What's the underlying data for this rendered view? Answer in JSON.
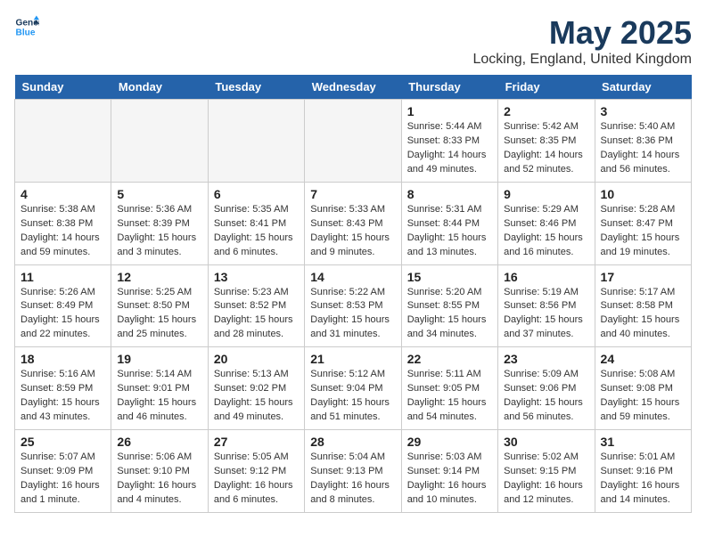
{
  "header": {
    "logo_line1": "General",
    "logo_line2": "Blue",
    "month": "May 2025",
    "location": "Locking, England, United Kingdom"
  },
  "weekdays": [
    "Sunday",
    "Monday",
    "Tuesday",
    "Wednesday",
    "Thursday",
    "Friday",
    "Saturday"
  ],
  "weeks": [
    [
      {
        "day": "",
        "info": ""
      },
      {
        "day": "",
        "info": ""
      },
      {
        "day": "",
        "info": ""
      },
      {
        "day": "",
        "info": ""
      },
      {
        "day": "1",
        "info": "Sunrise: 5:44 AM\nSunset: 8:33 PM\nDaylight: 14 hours\nand 49 minutes."
      },
      {
        "day": "2",
        "info": "Sunrise: 5:42 AM\nSunset: 8:35 PM\nDaylight: 14 hours\nand 52 minutes."
      },
      {
        "day": "3",
        "info": "Sunrise: 5:40 AM\nSunset: 8:36 PM\nDaylight: 14 hours\nand 56 minutes."
      }
    ],
    [
      {
        "day": "4",
        "info": "Sunrise: 5:38 AM\nSunset: 8:38 PM\nDaylight: 14 hours\nand 59 minutes."
      },
      {
        "day": "5",
        "info": "Sunrise: 5:36 AM\nSunset: 8:39 PM\nDaylight: 15 hours\nand 3 minutes."
      },
      {
        "day": "6",
        "info": "Sunrise: 5:35 AM\nSunset: 8:41 PM\nDaylight: 15 hours\nand 6 minutes."
      },
      {
        "day": "7",
        "info": "Sunrise: 5:33 AM\nSunset: 8:43 PM\nDaylight: 15 hours\nand 9 minutes."
      },
      {
        "day": "8",
        "info": "Sunrise: 5:31 AM\nSunset: 8:44 PM\nDaylight: 15 hours\nand 13 minutes."
      },
      {
        "day": "9",
        "info": "Sunrise: 5:29 AM\nSunset: 8:46 PM\nDaylight: 15 hours\nand 16 minutes."
      },
      {
        "day": "10",
        "info": "Sunrise: 5:28 AM\nSunset: 8:47 PM\nDaylight: 15 hours\nand 19 minutes."
      }
    ],
    [
      {
        "day": "11",
        "info": "Sunrise: 5:26 AM\nSunset: 8:49 PM\nDaylight: 15 hours\nand 22 minutes."
      },
      {
        "day": "12",
        "info": "Sunrise: 5:25 AM\nSunset: 8:50 PM\nDaylight: 15 hours\nand 25 minutes."
      },
      {
        "day": "13",
        "info": "Sunrise: 5:23 AM\nSunset: 8:52 PM\nDaylight: 15 hours\nand 28 minutes."
      },
      {
        "day": "14",
        "info": "Sunrise: 5:22 AM\nSunset: 8:53 PM\nDaylight: 15 hours\nand 31 minutes."
      },
      {
        "day": "15",
        "info": "Sunrise: 5:20 AM\nSunset: 8:55 PM\nDaylight: 15 hours\nand 34 minutes."
      },
      {
        "day": "16",
        "info": "Sunrise: 5:19 AM\nSunset: 8:56 PM\nDaylight: 15 hours\nand 37 minutes."
      },
      {
        "day": "17",
        "info": "Sunrise: 5:17 AM\nSunset: 8:58 PM\nDaylight: 15 hours\nand 40 minutes."
      }
    ],
    [
      {
        "day": "18",
        "info": "Sunrise: 5:16 AM\nSunset: 8:59 PM\nDaylight: 15 hours\nand 43 minutes."
      },
      {
        "day": "19",
        "info": "Sunrise: 5:14 AM\nSunset: 9:01 PM\nDaylight: 15 hours\nand 46 minutes."
      },
      {
        "day": "20",
        "info": "Sunrise: 5:13 AM\nSunset: 9:02 PM\nDaylight: 15 hours\nand 49 minutes."
      },
      {
        "day": "21",
        "info": "Sunrise: 5:12 AM\nSunset: 9:04 PM\nDaylight: 15 hours\nand 51 minutes."
      },
      {
        "day": "22",
        "info": "Sunrise: 5:11 AM\nSunset: 9:05 PM\nDaylight: 15 hours\nand 54 minutes."
      },
      {
        "day": "23",
        "info": "Sunrise: 5:09 AM\nSunset: 9:06 PM\nDaylight: 15 hours\nand 56 minutes."
      },
      {
        "day": "24",
        "info": "Sunrise: 5:08 AM\nSunset: 9:08 PM\nDaylight: 15 hours\nand 59 minutes."
      }
    ],
    [
      {
        "day": "25",
        "info": "Sunrise: 5:07 AM\nSunset: 9:09 PM\nDaylight: 16 hours\nand 1 minute."
      },
      {
        "day": "26",
        "info": "Sunrise: 5:06 AM\nSunset: 9:10 PM\nDaylight: 16 hours\nand 4 minutes."
      },
      {
        "day": "27",
        "info": "Sunrise: 5:05 AM\nSunset: 9:12 PM\nDaylight: 16 hours\nand 6 minutes."
      },
      {
        "day": "28",
        "info": "Sunrise: 5:04 AM\nSunset: 9:13 PM\nDaylight: 16 hours\nand 8 minutes."
      },
      {
        "day": "29",
        "info": "Sunrise: 5:03 AM\nSunset: 9:14 PM\nDaylight: 16 hours\nand 10 minutes."
      },
      {
        "day": "30",
        "info": "Sunrise: 5:02 AM\nSunset: 9:15 PM\nDaylight: 16 hours\nand 12 minutes."
      },
      {
        "day": "31",
        "info": "Sunrise: 5:01 AM\nSunset: 9:16 PM\nDaylight: 16 hours\nand 14 minutes."
      }
    ]
  ]
}
